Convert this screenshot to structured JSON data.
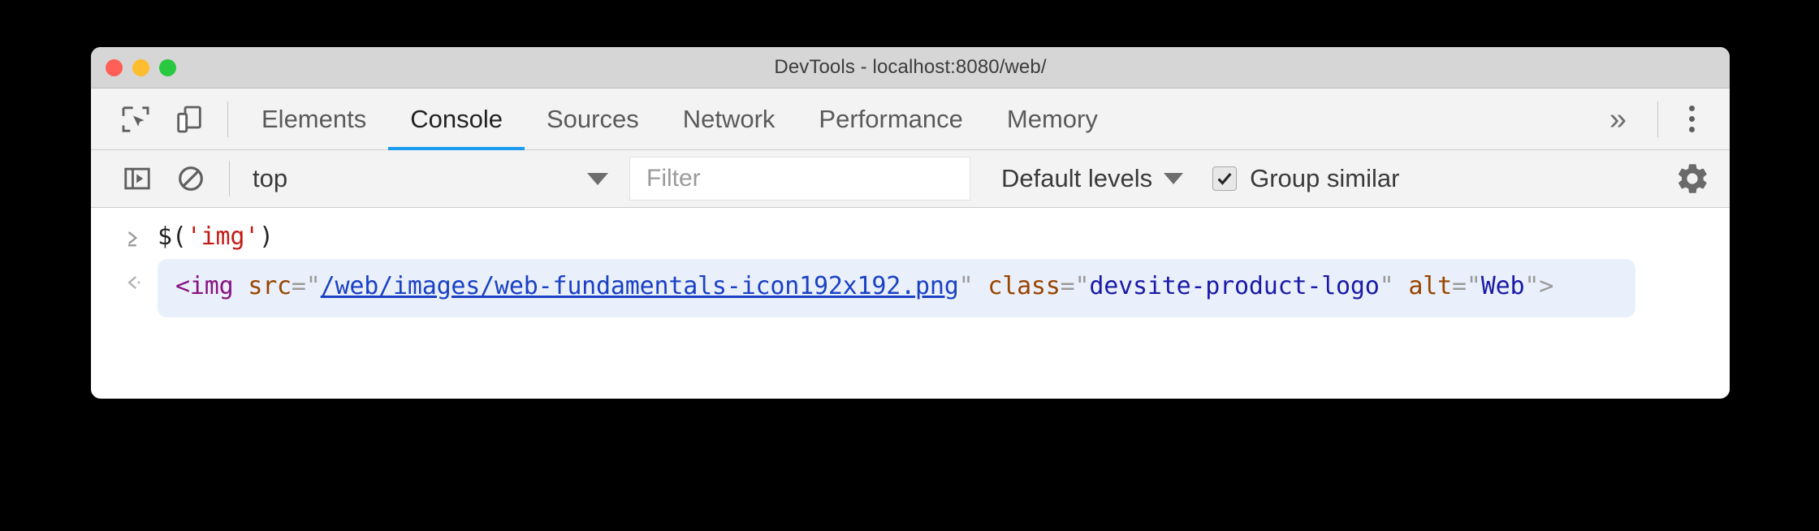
{
  "window": {
    "title": "DevTools - localhost:8080/web/",
    "traffic_lights": [
      "close",
      "minimize",
      "maximize"
    ],
    "colors": {
      "close": "#ff5f57",
      "minimize": "#febc2e",
      "maximize": "#28c840",
      "accent": "#1a9bf0",
      "titlebar_bg": "#d6d6d6",
      "toolbar_bg": "#f3f3f3",
      "result_bg": "#eaf0fb"
    }
  },
  "tabbar": {
    "inspect_icon": "inspect-element-icon",
    "device_icon": "device-toolbar-icon",
    "tabs": [
      {
        "label": "Elements",
        "active": false
      },
      {
        "label": "Console",
        "active": true
      },
      {
        "label": "Sources",
        "active": false
      },
      {
        "label": "Network",
        "active": false
      },
      {
        "label": "Performance",
        "active": false
      },
      {
        "label": "Memory",
        "active": false
      }
    ],
    "overflow_label": "»",
    "more_icon": "kebab-menu-icon"
  },
  "console_toolbar": {
    "sidebar_icon": "console-sidebar-icon",
    "clear_icon": "clear-console-icon",
    "context": {
      "value": "top",
      "caret": "chevron-down-icon"
    },
    "filter": {
      "value": "",
      "placeholder": "Filter"
    },
    "levels": {
      "label": "Default levels",
      "caret": "chevron-down-icon"
    },
    "group_similar": {
      "label": "Group similar",
      "checked": true
    },
    "settings_icon": "gear-icon"
  },
  "console": {
    "input": {
      "prompt": "›",
      "code_prefix": "$(",
      "code_string": "'img'",
      "code_suffix": ")"
    },
    "result": {
      "prompt": "‹",
      "tag_open": "<img",
      "attr_src": "src",
      "eq": "=",
      "quote": "\"",
      "src_value": "/web/images/web-fundamentals-icon192x192.png",
      "attr_class": "class",
      "class_value": "devsite-product-logo",
      "attr_alt": "alt",
      "alt_value": "Web",
      "tag_close": ">"
    }
  }
}
